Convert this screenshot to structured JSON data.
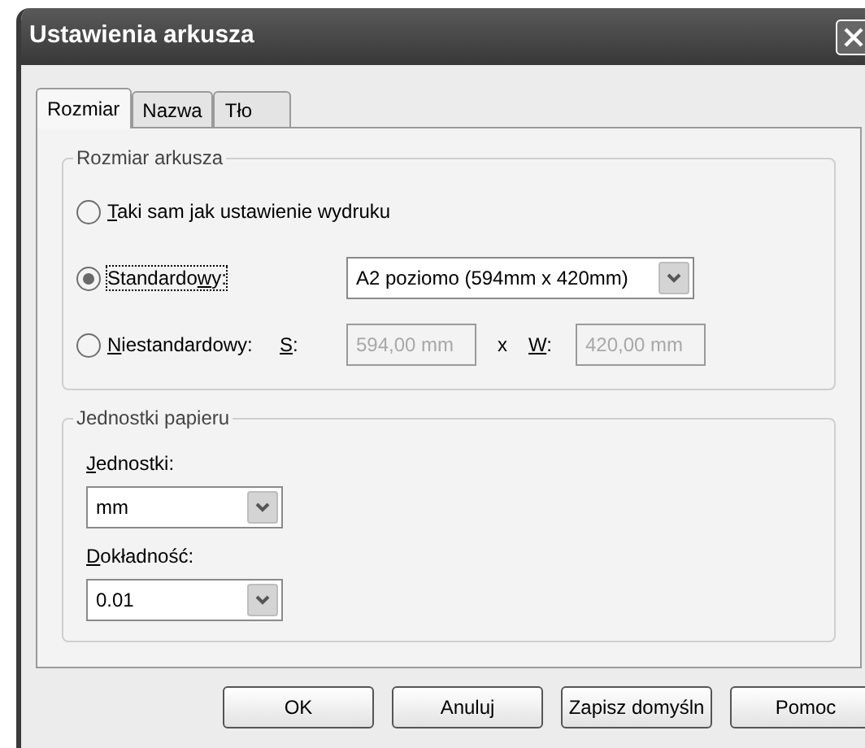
{
  "window": {
    "title": "Ustawienia arkusza"
  },
  "tabs": [
    {
      "label": "Rozmiar",
      "selected": true
    },
    {
      "label": "Nazwa",
      "selected": false
    },
    {
      "label": "Tło",
      "selected": false
    }
  ],
  "size_group": {
    "title": "Rozmiar arkusza",
    "options": [
      {
        "kind": "plain",
        "accel": "T",
        "after": "aki sam jak ustawienie wydruku",
        "selected": false,
        "focused": false
      },
      {
        "kind": "preset",
        "before": "Standardo",
        "accel": "w",
        "after": "y:",
        "selected": true,
        "focused": true,
        "value": "A2 poziomo (594mm x 420mm)"
      },
      {
        "kind": "custom",
        "accel": "N",
        "after": "iestandardowy:",
        "selected": false,
        "focused": false,
        "width_label": {
          "accel": "S",
          "after": ":"
        },
        "width_value": "594,00 mm",
        "times": "x",
        "height_label": {
          "accel": "W",
          "after": ":"
        },
        "height_value": "420,00 mm",
        "disabled": true
      }
    ]
  },
  "units_group": {
    "title": "Jednostki papieru",
    "fields": [
      {
        "accel": "J",
        "after": "ednostki:",
        "value": "mm"
      },
      {
        "accel": "D",
        "after": "okładność:",
        "value": "0.01"
      }
    ]
  },
  "buttons": [
    {
      "label": "OK"
    },
    {
      "label": "Anuluj"
    },
    {
      "label": "Zapisz domyśln"
    },
    {
      "label": "Pomoc"
    }
  ]
}
